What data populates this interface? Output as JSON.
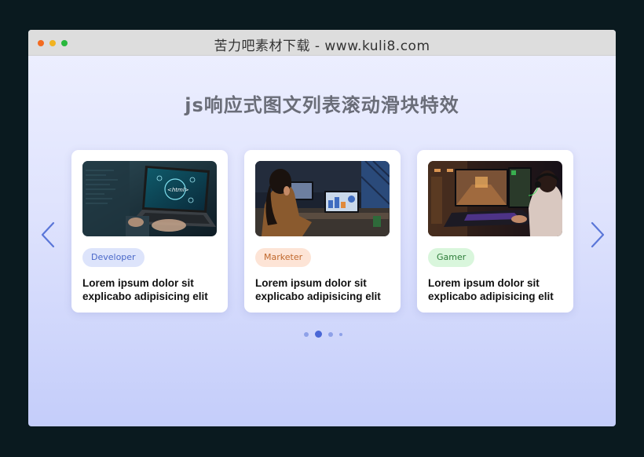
{
  "window": {
    "title": "苦力吧素材下载 - www.kuli8.com"
  },
  "page": {
    "heading": "js响应式图文列表滚动滑块特效"
  },
  "carousel": {
    "prev_icon": "chevron-left-icon",
    "next_icon": "chevron-right-icon",
    "accent_color": "#5a76d8",
    "cards": [
      {
        "tag": "Developer",
        "title": "Lorem ipsum dolor sit explicabo adipisicing elit",
        "image": "laptop-html-code"
      },
      {
        "tag": "Marketer",
        "title": "Lorem ipsum dolor sit explicabo adipisicing elit",
        "image": "woman-at-desk-analytics"
      },
      {
        "tag": "Gamer",
        "title": "Lorem ipsum dolor sit explicabo adipisicing elit",
        "image": "gamer-with-headset"
      }
    ],
    "pagination": {
      "total": 4,
      "active": 2
    }
  }
}
